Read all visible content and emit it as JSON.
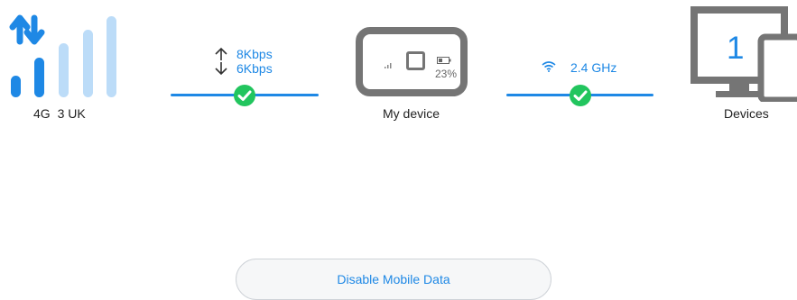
{
  "network": {
    "type": "4G",
    "carrier": "3 UK",
    "signal_level": 2,
    "signal_max": 4
  },
  "speed": {
    "upload": "8Kbps",
    "download": "6Kbps"
  },
  "device": {
    "label": "My device",
    "battery": "23%"
  },
  "wifi": {
    "band": "2.4 GHz"
  },
  "devices": {
    "count": "1",
    "label": "Devices"
  },
  "actions": {
    "disable_mobile_data": "Disable Mobile Data"
  },
  "colors": {
    "accent": "#1e88e5",
    "ok": "#22c55e",
    "device_gray": "#757575",
    "bar_inactive": "#bcdcf8"
  }
}
